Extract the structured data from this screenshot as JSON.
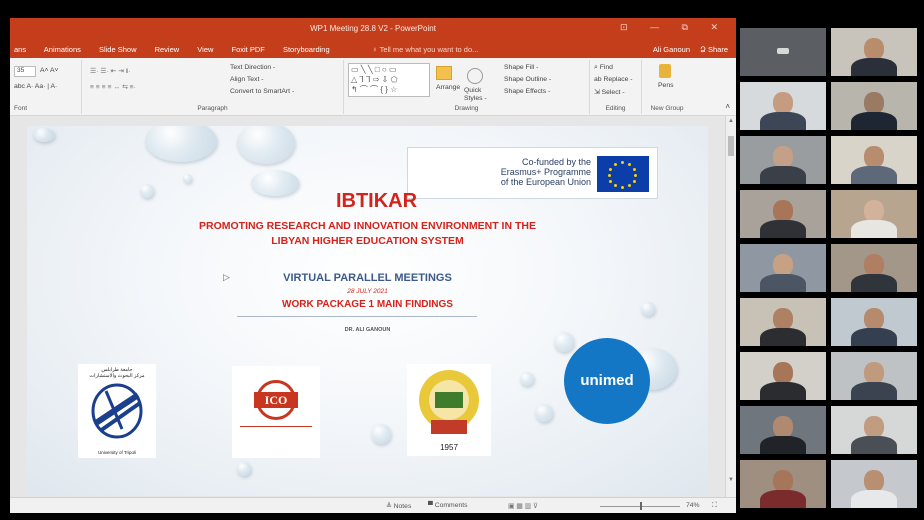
{
  "window": {
    "title": "WP1 Meeting 28.8 V2 - PowerPoint",
    "controls": "⊡  —  ⧉  ✕"
  },
  "menubar": {
    "tabs": [
      "ans",
      "Animations",
      "Slide Show",
      "Review",
      "View",
      "Foxit PDF",
      "Storyboarding"
    ],
    "tell_me": "♀ Tell me what you want to do...",
    "user": "Ali Ganoun",
    "share": "Ձ Share"
  },
  "ribbon": {
    "font_group_label": "Font",
    "font_size": "35",
    "paragraph_group_label": "Paragraph",
    "text_direction": "Text Direction -",
    "align_text": "Align Text -",
    "convert_smartart": "Convert to SmartArt -",
    "drawing_group_label": "Drawing",
    "arrange": "Arrange",
    "quick_styles": "Quick Styles -",
    "shape_fill": "Shape Fill -",
    "shape_outline": "Shape Outline -",
    "shape_effects": "Shape Effects -",
    "editing_group_label": "Editing",
    "find": "Find",
    "replace": "Replace -",
    "select": "Select -",
    "pens": "Pens",
    "new_group_label": "New Group"
  },
  "slide": {
    "eu_line1": "Co-funded by the",
    "eu_line2": "Erasmus+ Programme",
    "eu_line3": "of the European Union",
    "title": "IBTIKAR",
    "subtitle_line1": "PROMOTING RESEARCH AND INNOVATION ENVIRONMENT IN THE",
    "subtitle_line2": "LIBYAN HIGHER EDUCATION SYSTEM",
    "meetings": "VIRTUAL PARALLEL MEETINGS",
    "date": "28 JULY 2021",
    "findings": "WORK PACKAGE 1 MAIN FINDINGS",
    "presenter": "DR. ALI GANOUN",
    "logo1_caption": "University of Tripoli",
    "logo2_text": "ICO",
    "logo3_year": "1957",
    "unimed": "unimed"
  },
  "statusbar": {
    "notes": "≜ Notes",
    "comments": "▀ Comments",
    "zoom": "74%"
  },
  "colors": {
    "ppt_red": "#c43e1c",
    "title_red": "#d5231b",
    "meeting_blue": "#3c5a8c",
    "eu_blue": "#0b3ea8",
    "unimed_blue": "#1377c6"
  }
}
